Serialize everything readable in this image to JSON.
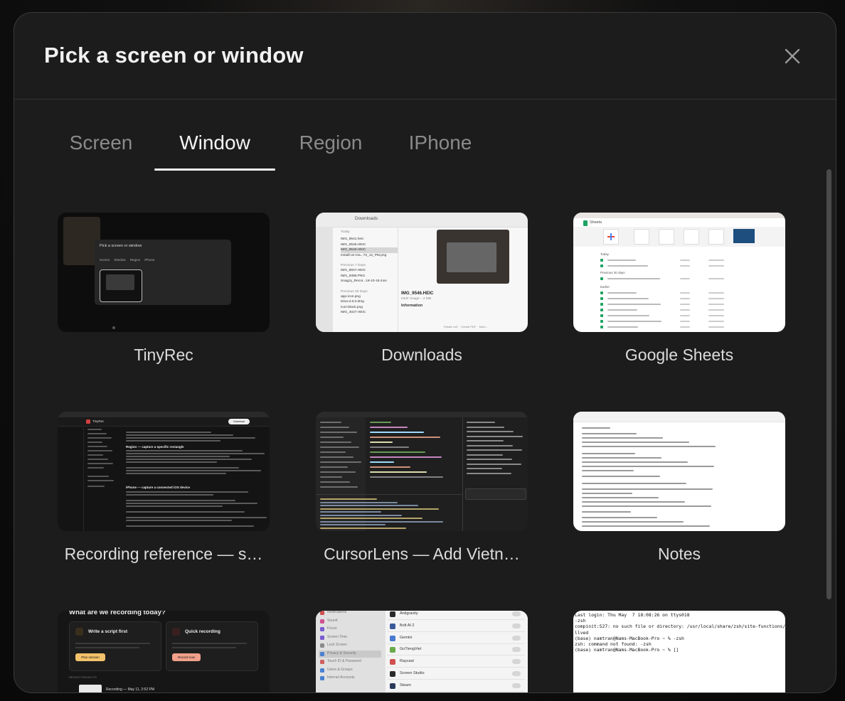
{
  "dialog": {
    "title": "Pick a screen or window"
  },
  "tabs": [
    {
      "label": "Screen",
      "active": false
    },
    {
      "label": "Window",
      "active": true
    },
    {
      "label": "Region",
      "active": false
    },
    {
      "label": "IPhone",
      "active": false
    }
  ],
  "windows": [
    {
      "label": "TinyRec"
    },
    {
      "label": "Downloads"
    },
    {
      "label": "Google Sheets"
    },
    {
      "label": "Recording reference — s…"
    },
    {
      "label": "CursorLens — Add Vietn…"
    },
    {
      "label": "Notes"
    },
    {
      "label": ""
    },
    {
      "label": ""
    },
    {
      "label": ""
    }
  ],
  "thumbnails": {
    "tinyrec": {
      "dialog_title": "Pick a screen or window",
      "tabs": [
        "Screen",
        "Window",
        "Region",
        "iPhone"
      ]
    },
    "downloads": {
      "toolbar_title": "Downloads",
      "section_today": "Today",
      "today_files": [
        "IMG_9541.heic",
        "IMG_9545.HEIC",
        "IMG_9546.HEIC",
        "Install-on-ma...72_12_PM.png"
      ],
      "section_prev7": "Previous 7 Days",
      "prev7_files": [
        "IMG_8847.HEIC",
        "IMG_9386.PNG",
        "Snagzy_Recor...18-10-18.mov"
      ],
      "section_prev30": "Previous 30 Days",
      "prev30_files": [
        "app-icon.png",
        "Dina-3.6.0.dmg",
        "icon-black.png",
        "IMG_4027.HEIC"
      ],
      "preview_name": "IMG_9546.HEIC",
      "preview_meta": "HEIF Image – 2 MB",
      "preview_info": "Information",
      "actions": [
        "Rotate Left",
        "Create PDF",
        "More..."
      ]
    },
    "sheets": {
      "app_name": "Sheets",
      "section_today": "Today",
      "section_prev30": "Previous 30 days",
      "section_earlier": "Earlier"
    },
    "recording_ref": {
      "brand": "TinyRec",
      "heading_region": "Region — capture a specific rectangle",
      "heading_iphone": "iPhone — capture a connected iOS device",
      "download": "Download"
    },
    "cursorlens": {},
    "notes": {},
    "tinyrec_home": {
      "heading": "What are we recording today?",
      "card1_title": "Write a script first",
      "card1_button": "Plan session",
      "card2_title": "Quick recording",
      "card2_button": "Record now",
      "recent": "RECENT PROJECTS",
      "recent_item": "Recording — May 11, 2:52 PM"
    },
    "settings": {
      "sidebar": [
        "Notifications",
        "Sound",
        "Focus",
        "Screen Time",
        "Lock Screen",
        "Privacy & Security",
        "Touch ID & Password",
        "Users & Groups",
        "Internet Accounts"
      ],
      "apps": [
        "Antigravity",
        "Bolt AI 2",
        "Gemini",
        "GoTiengViet",
        "Raycast",
        "Screen Studio",
        "Steam"
      ]
    },
    "terminal": {
      "lines": [
        "Last login: Thu May  7 18:08:26 on ttys018",
        "-zsh",
        "compinit:527: no such file or directory: /usr/local/share/zsh/site-functions/_mu",
        "llved",
        "(base) namtran@Nams-MacBook-Pro ~ % -zsh",
        "zsh: command not found: -zsh",
        "(base) namtran@Nams-MacBook-Pro ~ % []"
      ]
    }
  },
  "colors": {
    "modal_bg": "#1c1c1c",
    "text_primary": "#f2f2f2",
    "text_muted": "#8a8a8a",
    "label_text": "#dcdcdc",
    "tinyrec_accent": "#f3c26b",
    "sheets_green": "#1ea362"
  }
}
